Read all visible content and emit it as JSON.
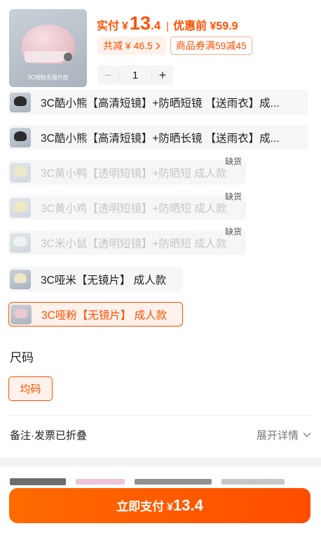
{
  "product": {
    "thumbnail_caption": "3C哑粉无镜片款",
    "price_label": "实付",
    "price_yen": "¥",
    "price_int": "13",
    "price_dec": ".4",
    "separator": "|",
    "original_price": "优惠前 ¥59.9",
    "discount_badge": "共减 ¥ 46.5",
    "coupon_badge": "商品券满59减45",
    "quantity": "1",
    "minus_label": "−",
    "plus_label": "+"
  },
  "options": [
    {
      "label": "3C酷小熊【高清短镜】+防晒短镜 【送雨衣】成...",
      "state": "available",
      "helmet_color": "#2b2b2b"
    },
    {
      "label": "3C酷小熊【高清短镜】+防晒长镜 【送雨衣】成...",
      "state": "available",
      "helmet_color": "#2b2b2b"
    },
    {
      "label": "3C黄小鸭【透明短镜】+防晒短 成人款",
      "state": "sold_out",
      "soldout_label": "缺货",
      "helmet_color": "#e9d98a"
    },
    {
      "label": "3C黄小鸡【透明短镜】+防晒短 成人款",
      "state": "sold_out",
      "soldout_label": "缺货",
      "helmet_color": "#eadc7a"
    },
    {
      "label": "3C米小鼠【透明短镜】+防晒短 成人款",
      "state": "sold_out",
      "soldout_label": "缺货",
      "helmet_color": "#eeeeee"
    },
    {
      "label": "3C哑米【无镜片】 成人款",
      "state": "available",
      "helmet_color": "#efe6c8"
    },
    {
      "label": "3C哑粉【无镜片】 成人款",
      "state": "selected",
      "helmet_color": "#edc9cf"
    }
  ],
  "size_section": {
    "title": "尺码",
    "selected": "均码"
  },
  "notes": {
    "label": "备注·发票已折叠",
    "expand": "展开详情"
  },
  "pay_button": {
    "label": "立即支付",
    "yen": "¥",
    "amount": "13.4"
  },
  "colors": {
    "accent": "#ff5000",
    "accent_bg": "#fff1eb"
  }
}
